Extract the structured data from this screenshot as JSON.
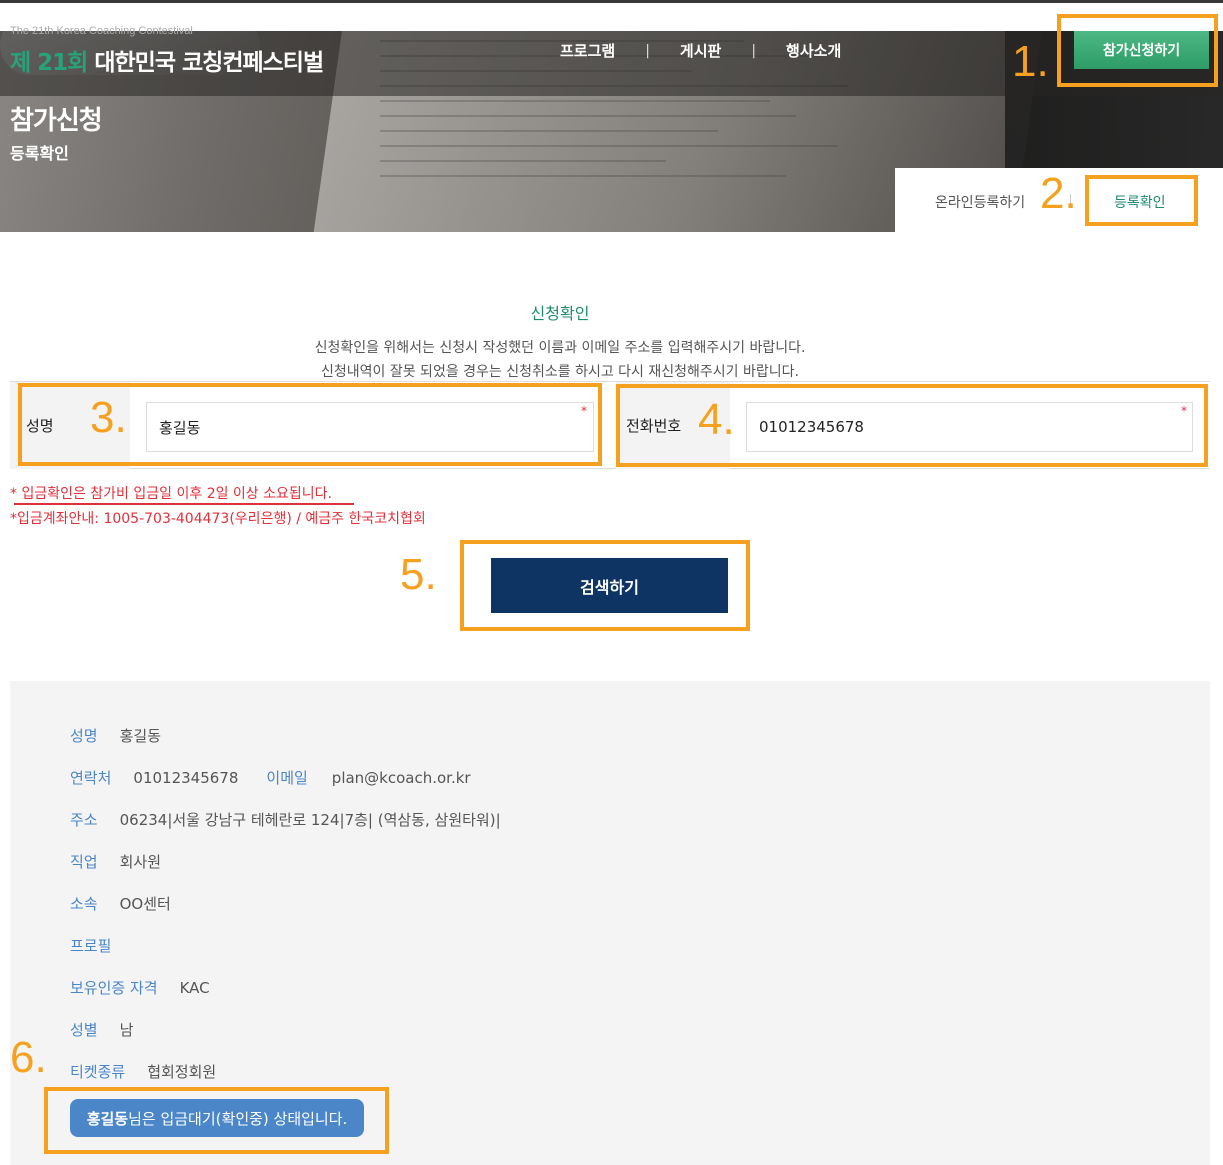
{
  "header": {
    "subtitle_en": "The 21th Korea Coaching Contestival",
    "logo_accent": "제 21회",
    "logo_main": "대한민국 코칭컨페스티벌",
    "nav": [
      "프로그램",
      "게시판",
      "행사소개"
    ],
    "nav_separator": "|",
    "cta": "참가신청하기"
  },
  "page": {
    "title": "참가신청",
    "subtitle": "등록확인"
  },
  "subtabs": {
    "online": "온라인등록하기",
    "confirm": "등록확인"
  },
  "form": {
    "title": "신청확인",
    "desc1": "신청확인을 위해서는 신청시 작성했던 이름과 이메일 주소를 입력해주시기 바랍니다.",
    "desc2": "신청내역이 잘못 되었을 경우는 신청취소를 하시고 다시 재신청해주시기 바랍니다.",
    "name_label": "성명",
    "name_value": "홍길동",
    "phone_label": "전화번호",
    "phone_value": "01012345678",
    "required_mark": "*",
    "notice1": "* 입금확인은 참가비 입금일 이후 2일 이상 소요됩니다.",
    "notice2": "*입금계좌안내: 1005-703-404473(우리은행) / 예금주 한국코치협회",
    "search_button": "검색하기"
  },
  "result": {
    "name_label": "성명",
    "name_value": "홍길동",
    "contact_label": "연락처",
    "contact_value": "01012345678",
    "email_label": "이메일",
    "email_value": "plan@kcoach.or.kr",
    "address_label": "주소",
    "address_value": "06234|서울 강남구 테헤란로 124|7층| (역삼동, 삼원타워)|",
    "job_label": "직업",
    "job_value": "회사원",
    "affiliation_label": "소속",
    "affiliation_value": "OO센터",
    "profile_label": "프로필",
    "cert_label": "보유인증 자격",
    "cert_value": "KAC",
    "gender_label": "성별",
    "gender_value": "남",
    "ticket_label": "티켓종류",
    "ticket_value": "협회정회원",
    "status_name": "홍길동",
    "status_text": "님은 입금대기(확인중) 상태입니다."
  },
  "annotations": [
    "1.",
    "2.",
    "3.",
    "4.",
    "5.",
    "6."
  ],
  "colors": {
    "accent_green": "#27a27a",
    "cta_green": "#3aa873",
    "navy_button": "#0d3462",
    "label_blue": "#4a86c8",
    "notice_red": "#e0303a",
    "annotation_orange": "#f5a01f"
  }
}
